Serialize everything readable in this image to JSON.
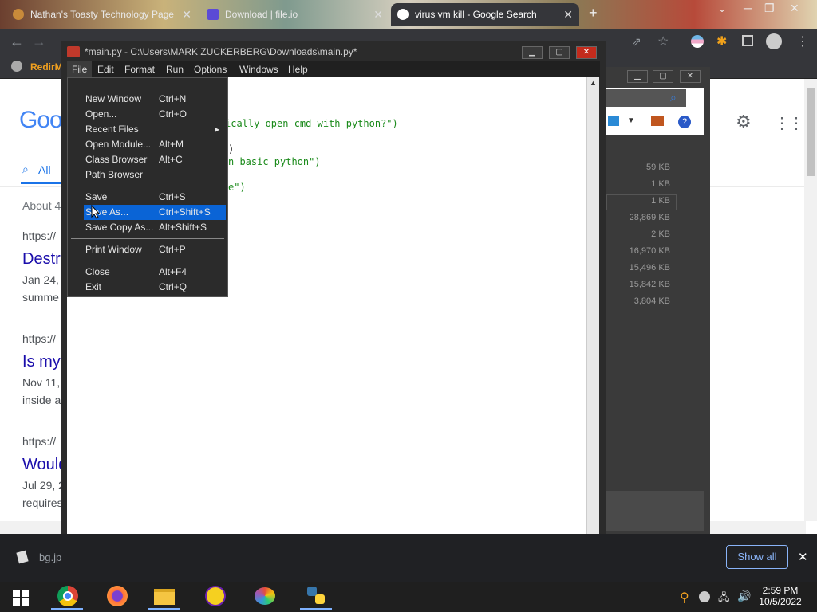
{
  "browser": {
    "tabs": [
      {
        "title": "Nathan's Toasty Technology Page"
      },
      {
        "title": "Download | file.io"
      },
      {
        "title": "virus vm kill - Google Search",
        "active": true
      }
    ],
    "bookmark_label": "RedirM"
  },
  "google": {
    "logo_fragment": "Goo",
    "all_tab": "All",
    "stats": "About 4",
    "results": [
      {
        "url": "https://",
        "title": "Destr",
        "date": "Jan 24,",
        "snippet": "summe"
      },
      {
        "url": "https://",
        "title": "Is my",
        "date": "Nov 11,",
        "snippet": "inside a"
      },
      {
        "url": "https://",
        "title": "Would",
        "date": "Jul 29, 2",
        "snippet": "requires"
      }
    ]
  },
  "explorer": {
    "sizes": [
      "59 KB",
      "1 KB",
      "1 KB",
      "28,869 KB",
      "2 KB",
      "16,970 KB",
      "15,496 KB",
      "15,842 KB",
      "3,804 KB"
    ]
  },
  "idle": {
    "title": "*main.py - C:\\Users\\MARK ZUCKERBERG\\Downloads\\main.py*",
    "menus": [
      "File",
      "Edit",
      "Format",
      "Run",
      "Options",
      "Windows",
      "Help"
    ],
    "code_lines": [
      "ically open cmd with python?\")",
      ")",
      "n basic python\")",
      "e\")"
    ],
    "file_menu": {
      "groups": [
        [
          {
            "label": "New Window",
            "accel": "Ctrl+N"
          },
          {
            "label": "Open...",
            "accel": "Ctrl+O"
          },
          {
            "label": "Recent Files",
            "accel": "",
            "submenu": true
          },
          {
            "label": "Open Module...",
            "accel": "Alt+M"
          },
          {
            "label": "Class Browser",
            "accel": "Alt+C"
          },
          {
            "label": "Path Browser",
            "accel": ""
          }
        ],
        [
          {
            "label": "Save",
            "accel": "Ctrl+S"
          },
          {
            "label": "Save As...",
            "accel": "Ctrl+Shift+S",
            "selected": true
          },
          {
            "label": "Save Copy As...",
            "accel": "Alt+Shift+S"
          }
        ],
        [
          {
            "label": "Print Window",
            "accel": "Ctrl+P"
          }
        ],
        [
          {
            "label": "Close",
            "accel": "Alt+F4"
          },
          {
            "label": "Exit",
            "accel": "Ctrl+Q"
          }
        ]
      ]
    }
  },
  "download_bar": {
    "file": "bg.jp",
    "show_all": "Show all"
  },
  "taskbar": {
    "time": "2:59 PM",
    "date": "10/5/2022"
  },
  "colors": {
    "selection": "#0a64d6",
    "code_green": "#1a8a1a",
    "link_blue": "#1a0dab"
  }
}
